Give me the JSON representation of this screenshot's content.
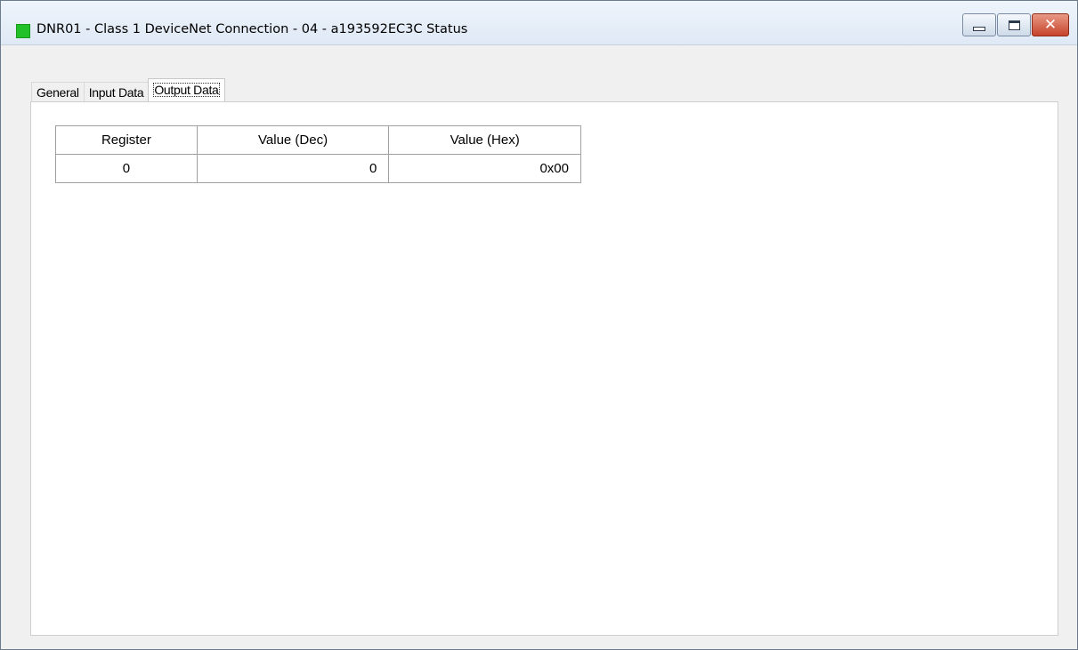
{
  "window": {
    "title": "DNR01 - Class 1 DeviceNet Connection - 04 - a193592EC3C Status",
    "status_color": "#22c12a",
    "controls": {
      "minimize_icon": "minimize-icon",
      "maximize_icon": "maximize-icon",
      "close_icon": "close-icon"
    }
  },
  "tabs": [
    {
      "label": "General",
      "active": false
    },
    {
      "label": "Input Data",
      "active": false
    },
    {
      "label": "Output Data",
      "active": true
    }
  ],
  "table": {
    "headers": [
      "Register",
      "Value (Dec)",
      "Value (Hex)"
    ],
    "rows": [
      [
        "0",
        "0",
        "0x00"
      ]
    ]
  }
}
